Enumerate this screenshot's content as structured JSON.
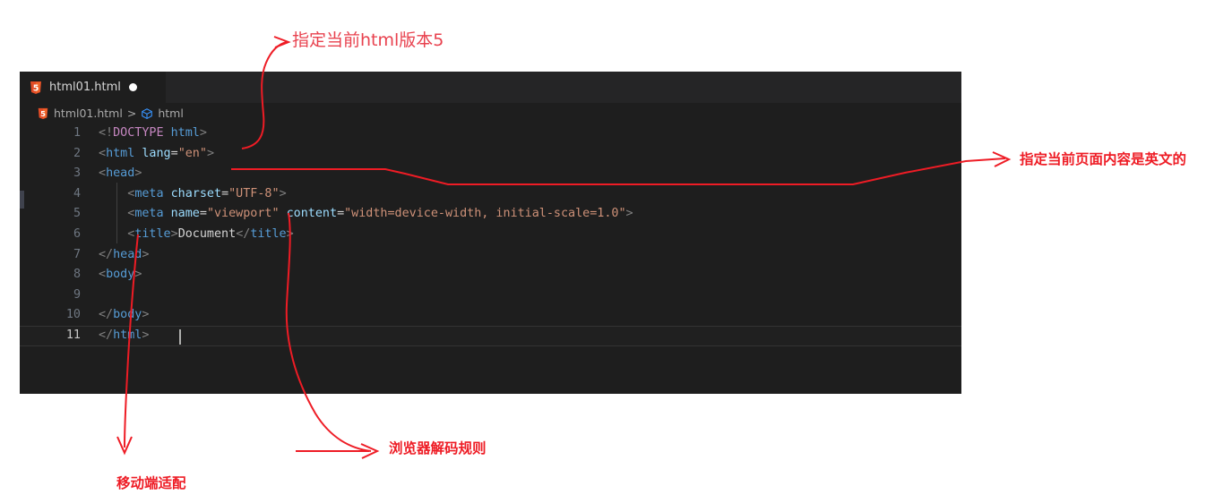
{
  "editor": {
    "tab": {
      "icon": "html5-file-icon",
      "filename": "html01.html",
      "dirty_indicator": "unsaved-dot"
    },
    "breadcrumb": {
      "file_icon": "html5-file-icon",
      "file": "html01.html",
      "separator": ">",
      "symbol_icon": "symbol-structure-icon",
      "symbol": "html"
    },
    "theme": {
      "background": "#1e1e1e",
      "tabbar_background": "#252526",
      "line_number_color": "#6e7681",
      "active_line_number_color": "#c6c6c6",
      "tag_color": "#569cd6",
      "attribute_color": "#9cdcfe",
      "string_color": "#ce9178",
      "punctuation_color": "#808080",
      "doctype_keyword_color": "#c586c0",
      "text_color": "#d4d4d4"
    },
    "lines": [
      {
        "number": "1",
        "active": false,
        "tokens": [
          {
            "t": "<!",
            "c": "tok-punct"
          },
          {
            "t": "DOCTYPE",
            "c": "tok-doctype"
          },
          {
            "t": " ",
            "c": "tok-text"
          },
          {
            "t": "html",
            "c": "tok-dtname"
          },
          {
            "t": ">",
            "c": "tok-punct"
          }
        ]
      },
      {
        "number": "2",
        "active": false,
        "tokens": [
          {
            "t": "<",
            "c": "tok-punct"
          },
          {
            "t": "html",
            "c": "tok-tag"
          },
          {
            "t": " ",
            "c": "tok-text"
          },
          {
            "t": "lang",
            "c": "tok-attr"
          },
          {
            "t": "=",
            "c": "tok-eq"
          },
          {
            "t": "\"en\"",
            "c": "tok-string"
          },
          {
            "t": ">",
            "c": "tok-punct"
          }
        ]
      },
      {
        "number": "3",
        "active": false,
        "tokens": [
          {
            "t": "<",
            "c": "tok-punct"
          },
          {
            "t": "head",
            "c": "tok-tag"
          },
          {
            "t": ">",
            "c": "tok-punct"
          }
        ]
      },
      {
        "number": "4",
        "active": false,
        "tokens": [
          {
            "t": "    <",
            "c": "tok-punct"
          },
          {
            "t": "meta",
            "c": "tok-tag"
          },
          {
            "t": " ",
            "c": "tok-text"
          },
          {
            "t": "charset",
            "c": "tok-attr"
          },
          {
            "t": "=",
            "c": "tok-eq"
          },
          {
            "t": "\"UTF-8\"",
            "c": "tok-string"
          },
          {
            "t": ">",
            "c": "tok-punct"
          }
        ]
      },
      {
        "number": "5",
        "active": false,
        "tokens": [
          {
            "t": "    <",
            "c": "tok-punct"
          },
          {
            "t": "meta",
            "c": "tok-tag"
          },
          {
            "t": " ",
            "c": "tok-text"
          },
          {
            "t": "name",
            "c": "tok-attr"
          },
          {
            "t": "=",
            "c": "tok-eq"
          },
          {
            "t": "\"viewport\"",
            "c": "tok-string"
          },
          {
            "t": " ",
            "c": "tok-text"
          },
          {
            "t": "content",
            "c": "tok-attr"
          },
          {
            "t": "=",
            "c": "tok-eq"
          },
          {
            "t": "\"width=device-width, initial-scale=1.0\"",
            "c": "tok-string"
          },
          {
            "t": ">",
            "c": "tok-punct"
          }
        ]
      },
      {
        "number": "6",
        "active": false,
        "tokens": [
          {
            "t": "    <",
            "c": "tok-punct"
          },
          {
            "t": "title",
            "c": "tok-tag"
          },
          {
            "t": ">",
            "c": "tok-punct"
          },
          {
            "t": "Document",
            "c": "tok-text"
          },
          {
            "t": "</",
            "c": "tok-punct"
          },
          {
            "t": "title",
            "c": "tok-tag"
          },
          {
            "t": ">",
            "c": "tok-punct"
          }
        ]
      },
      {
        "number": "7",
        "active": false,
        "tokens": [
          {
            "t": "</",
            "c": "tok-punct"
          },
          {
            "t": "head",
            "c": "tok-tag"
          },
          {
            "t": ">",
            "c": "tok-punct"
          }
        ]
      },
      {
        "number": "8",
        "active": false,
        "tokens": [
          {
            "t": "<",
            "c": "tok-punct"
          },
          {
            "t": "body",
            "c": "tok-tag"
          },
          {
            "t": ">",
            "c": "tok-punct"
          }
        ]
      },
      {
        "number": "9",
        "active": false,
        "tokens": []
      },
      {
        "number": "10",
        "active": false,
        "tokens": [
          {
            "t": "</",
            "c": "tok-punct"
          },
          {
            "t": "body",
            "c": "tok-tag"
          },
          {
            "t": ">",
            "c": "tok-punct"
          }
        ]
      },
      {
        "number": "11",
        "active": true,
        "tokens": [
          {
            "t": "</",
            "c": "tok-punct"
          },
          {
            "t": "html",
            "c": "tok-tag"
          },
          {
            "t": ">",
            "c": "tok-punct"
          }
        ]
      }
    ]
  },
  "annotations": {
    "color": "#ee1c25",
    "doctype": {
      "text": "指定当前html版本5",
      "target_line": "1"
    },
    "lang": {
      "text": "指定当前页面内容是英文的",
      "target_line": "2"
    },
    "charset": {
      "text": "浏览器解码规则",
      "target_line": "4"
    },
    "viewport": {
      "text": "移动端适配",
      "target_line": "5"
    }
  }
}
